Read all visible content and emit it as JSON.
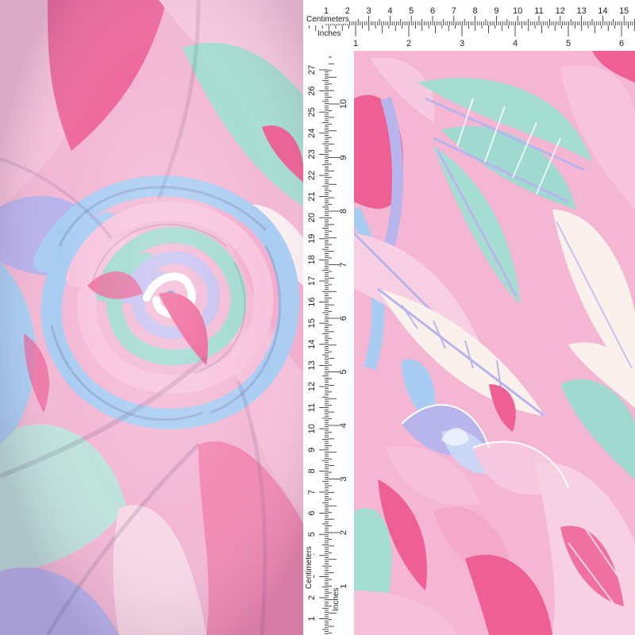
{
  "rulers": {
    "centimeters_label": "Centimeters",
    "inches_label": "Inches",
    "top_cm_ticks": [
      "1",
      "2",
      "3",
      "4",
      "5",
      "6",
      "7",
      "8",
      "9",
      "10",
      "11",
      "12",
      "13",
      "14",
      "15",
      "1"
    ],
    "top_in_ticks": [
      "1",
      "2",
      "3",
      "4",
      "5",
      "6"
    ],
    "side_cm_ticks": [
      "27",
      "26",
      "25",
      "24",
      "23",
      "22",
      "21",
      "20",
      "19",
      "18",
      "17",
      "16",
      "15",
      "14",
      "13",
      "12",
      "11",
      "10",
      "9",
      "8",
      "7",
      "6",
      "5",
      "4",
      "3",
      "2",
      "1"
    ],
    "side_in_ticks": [
      "10",
      "9",
      "8",
      "7",
      "6",
      "5",
      "4",
      "3",
      "2",
      "1"
    ]
  },
  "colors": {
    "pink_base": "#f4b6d2",
    "hot_pink": "#ee5f94",
    "mint": "#9fd9cf",
    "lavender": "#b8b4ec",
    "sky_blue": "#a9cdf2",
    "cream": "#fbf1ec",
    "white": "#ffffff"
  }
}
